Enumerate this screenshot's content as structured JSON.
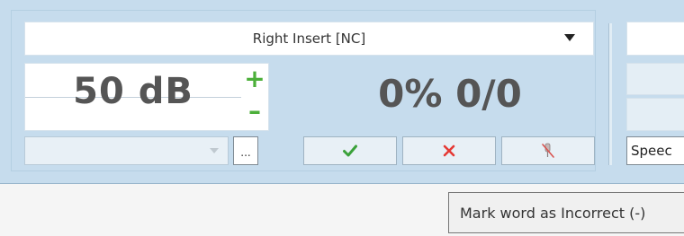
{
  "selector": {
    "label": "Right Insert [NC]",
    "caret_icon": "dropdown-caret-icon"
  },
  "level": {
    "value": "50 dB",
    "increase_label": "+",
    "decrease_label": "–"
  },
  "score": {
    "value": "0% 0/0"
  },
  "combo": {
    "value": ""
  },
  "browse_button": {
    "label": "..."
  },
  "mark_buttons": {
    "correct_icon": "check-icon",
    "incorrect_icon": "x-icon",
    "unmark_icon": "unmark-icon"
  },
  "right_panel": {
    "speech_field_value": "Speec"
  },
  "tooltip": {
    "text": "Mark word as Incorrect (-)"
  },
  "colors": {
    "panel_background": "#c6dced",
    "accent_green": "#4caf3a",
    "incorrect_red": "#e53935"
  }
}
